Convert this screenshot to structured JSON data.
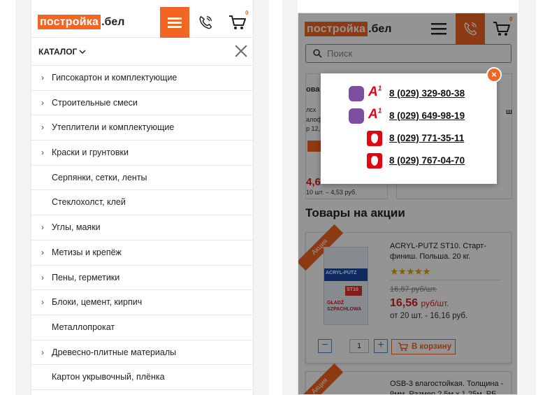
{
  "left_screen": {
    "logo": {
      "highlighted": "постройка",
      "tail": ".бел"
    },
    "header": {
      "cart_count": "0"
    },
    "catalog": {
      "title": "КАТАЛОГ",
      "items": [
        {
          "label": "Гипсокартон и комплектующие",
          "has_arrow": true
        },
        {
          "label": "Строительные смеси",
          "has_arrow": true
        },
        {
          "label": "Утеплители и комплектующие",
          "has_arrow": true
        },
        {
          "label": "Краски и грунтовки",
          "has_arrow": true
        },
        {
          "label": "Серпянки, сетки, ленты",
          "has_arrow": false
        },
        {
          "label": "Стеклохолст, клей",
          "has_arrow": false
        },
        {
          "label": "Углы, маяки",
          "has_arrow": true
        },
        {
          "label": "Метизы и крепёж",
          "has_arrow": true
        },
        {
          "label": "Пены, герметики",
          "has_arrow": true
        },
        {
          "label": "Блоки, цемент, кирпич",
          "has_arrow": true
        },
        {
          "label": "Металлопрокат",
          "has_arrow": false
        },
        {
          "label": "Древесно-плитные материалы",
          "has_arrow": true
        },
        {
          "label": "Картон укрывочный, плёнка",
          "has_arrow": false
        }
      ]
    }
  },
  "right_screen": {
    "logo": {
      "highlighted": "постройка",
      "tail": ".бел"
    },
    "header": {
      "cart_count": "0"
    },
    "search": {
      "placeholder": "Поиск"
    },
    "background_cards": {
      "price": "4,6",
      "bulk": "10 шт. – 4,53 руб.",
      "fragment_1": "ова",
      "fragment_2": "лсх",
      "fragment_3": "алоф",
      "fragment_4": "р 12,",
      "fragment_5": "ш"
    },
    "promo": {
      "title": "Товары на акции",
      "products": [
        {
          "badge": "Акция",
          "name_lines": [
            "ACRYL-PUTZ ST10. Старт-",
            "финиш. Польша. 20 кг."
          ],
          "stars": "★★★★★",
          "old_price": "16,87 руб/шт.",
          "price": "16,56",
          "price_unit": "руб/шт.",
          "bulk_price": "от 20 шт. - 16,16 руб.",
          "quantity": "1",
          "add_to_cart": "В корзину",
          "image_text_1": "ACRYL-PUTZ",
          "image_text_2": "ST10",
          "image_text_3": "GŁADŹ SZPACHLOWA"
        },
        {
          "badge": "Акция",
          "name_lines": [
            "OSB-3 влагостойкая. Толщина -",
            "9мм. Размер 2,5м х 1,25м. РБ"
          ]
        }
      ]
    },
    "phone_modal": {
      "close": "×",
      "phones": [
        {
          "number": "8 (029) 329-80-38",
          "operator": "A1",
          "viber": true
        },
        {
          "number": "8 (029) 649-98-19",
          "operator": "A1",
          "viber": true
        },
        {
          "number": "8 (029) 771-35-11",
          "operator": "MTS",
          "viber": false
        },
        {
          "number": "8 (029) 767-04-70",
          "operator": "MTS",
          "viber": false
        }
      ]
    }
  },
  "colors": {
    "brand": "#f26522",
    "price_red": "#d71e1e",
    "viber": "#7d4e9f",
    "a1": "#e3001b",
    "mts": "#e30611"
  }
}
